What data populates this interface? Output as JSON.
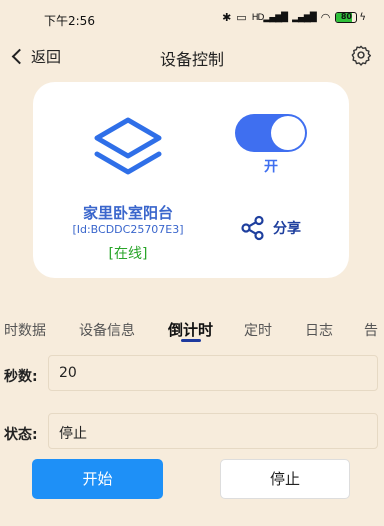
{
  "status_bar": {
    "time": "下午2:56",
    "bluetooth_icon": "bluetooth-icon",
    "signal_label": "HD",
    "battery_text": "80",
    "battery_level": 0.8,
    "battery_color": "#2fbf3a"
  },
  "nav": {
    "back_label": "返回",
    "title": "设备控制",
    "settings_icon": "gear-icon"
  },
  "device": {
    "name": "家里卧室阳台",
    "id_label": "[Id:BCDDC25707E3]",
    "status": "[在线]",
    "status_color": "#2aa52a",
    "power_on": true,
    "power_label": "开",
    "share_label": "分享"
  },
  "tabs": [
    {
      "label": "时数据",
      "active": false
    },
    {
      "label": "设备信息",
      "active": false
    },
    {
      "label": "倒计时",
      "active": true
    },
    {
      "label": "定时",
      "active": false
    },
    {
      "label": "日志",
      "active": false
    },
    {
      "label": "告",
      "active": false
    }
  ],
  "countdown": {
    "seconds_label": "秒数:",
    "seconds_value": "20",
    "state_label": "状态:",
    "state_value": "停止"
  },
  "actions": {
    "start_label": "开始",
    "stop_label": "停止"
  },
  "colors": {
    "background": "#f7ecdc",
    "accent": "#3f6ff0",
    "start_button": "#1e90f7"
  }
}
